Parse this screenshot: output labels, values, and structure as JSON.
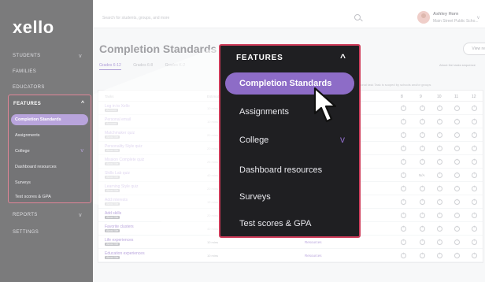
{
  "app": {
    "logo": "xello"
  },
  "sidebar": {
    "nav": [
      {
        "label": "STUDENTS",
        "chevron": "v"
      },
      {
        "label": "FAMILIES"
      },
      {
        "label": "EDUCATORS"
      }
    ],
    "features": {
      "label": "FEATURES",
      "chevron": "^",
      "items": [
        {
          "label": "Completion Standards",
          "active": true
        },
        {
          "label": "Assignments"
        },
        {
          "label": "College",
          "chevron": "v"
        },
        {
          "label": "Dashboard resources"
        },
        {
          "label": "Surveys"
        },
        {
          "label": "Test scores & GPA"
        }
      ]
    },
    "nav_after": [
      {
        "label": "REPORTS",
        "chevron": "v"
      },
      {
        "label": "SETTINGS"
      }
    ]
  },
  "topbar": {
    "search_placeholder": "Search for students, groups, and more",
    "user_name": "Ashley Horn",
    "user_org": "Main Street Public Scho...",
    "user_chevron": "v"
  },
  "main": {
    "title": "Completion Standards",
    "tabs": [
      {
        "label": "Grades 6-12",
        "active": true
      },
      {
        "label": "Grades 6-8"
      },
      {
        "label": "Grades K-2"
      }
    ],
    "view_report": "View report",
    "about": "About the tasks sequence",
    "table": {
      "col_tasks": "Tasks",
      "col_estimate": "Estimate",
      "legend": "Optional task  Task is scoped by schools and/or groups",
      "grades": [
        "8",
        "9",
        "10",
        "11",
        "12"
      ],
      "rows": [
        {
          "name": "Log in to Xello",
          "tag": "Account",
          "time": "10 mins",
          "resources": ""
        },
        {
          "name": "Personal email",
          "tag": "Account",
          "time": "10 mins",
          "resources": ""
        },
        {
          "name": "Matchmaker quiz",
          "tag": "About Me",
          "time": "20 mins",
          "resources": ""
        },
        {
          "name": "Personality Style quiz",
          "tag": "About Me",
          "time": "20 mins",
          "resources": ""
        },
        {
          "name": "Mission Complete quiz",
          "tag": "About Me",
          "time": "25 mins",
          "resources": ""
        },
        {
          "name": "Skills Lab quiz",
          "tag": "About Me",
          "time": "40 mins",
          "resources": "",
          "na": "N/A"
        },
        {
          "name": "Learning Style quiz",
          "tag": "About Me",
          "time": "20 mins",
          "resources": ""
        },
        {
          "name": "Add interests",
          "tag": "About Me",
          "time": "15 mins",
          "resources": ""
        },
        {
          "name": "Add skills",
          "tag": "About Me",
          "time": "20 mins",
          "resources": ""
        },
        {
          "name": "Favorite clusters",
          "tag": "About Me",
          "time": "40 mins",
          "resources": "Resources"
        },
        {
          "name": "Life experiences",
          "tag": "About Me",
          "time": "10 mins",
          "resources": "Resources"
        },
        {
          "name": "Education experiences",
          "tag": "About Me",
          "time": "10 mins",
          "resources": "Resources"
        }
      ]
    }
  },
  "zoom_panel": {
    "header": "FEATURES",
    "chevron": "^",
    "items": [
      {
        "label": "Completion Standards",
        "active": true
      },
      {
        "label": "Assignments"
      },
      {
        "label": "College",
        "chevron": "v"
      },
      {
        "label": "Dashboard resources"
      },
      {
        "label": "Surveys"
      },
      {
        "label": "Test scores & GPA"
      }
    ]
  },
  "colors": {
    "accent": "#8d6cc7",
    "highlight": "#cf3c5a",
    "sidebar": "#2a2a2d"
  }
}
